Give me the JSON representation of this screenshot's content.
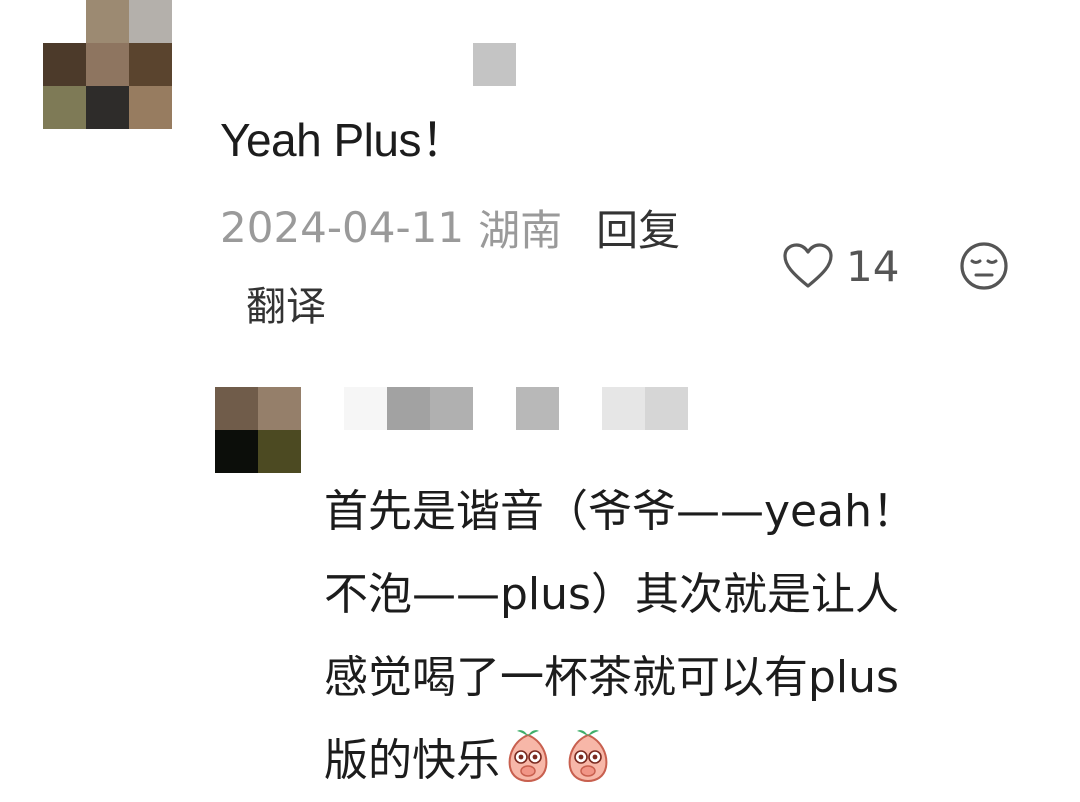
{
  "comment": {
    "text": "Yeah Plus！",
    "date": "2024-04-11",
    "location": "湖南",
    "reply_label": "回复",
    "translate_label": "翻译",
    "likes": "14"
  },
  "reply": {
    "lines": [
      "首先是谐音（爷爷——yeah！",
      "不泡——plus）其次就是让人",
      "感觉喝了一杯茶就可以有plus",
      "版的快乐"
    ],
    "emojis": [
      "peach-emoji",
      "peach-emoji"
    ]
  },
  "icons": {
    "like": "heart-outline-icon",
    "dislike": "meh-face-icon"
  },
  "colors": {
    "text": "#1c1c1c",
    "meta": "#9a9a9a",
    "action": "#333333"
  }
}
